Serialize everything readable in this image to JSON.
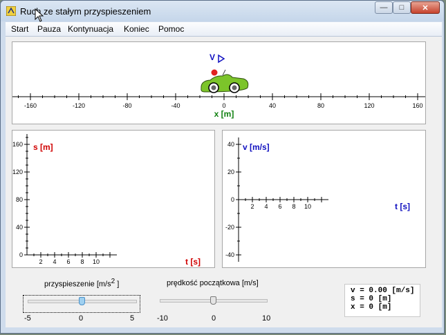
{
  "window": {
    "title": "Ruch ze stałym przyspieszeniem"
  },
  "menu": {
    "items": [
      "Start",
      "Pauza",
      "Kontynuacja",
      "Koniec",
      "Pomoc"
    ]
  },
  "track": {
    "axis_label": "x [m]",
    "ticks": [
      "-160",
      "-120",
      "-80",
      "-40",
      "0",
      "40",
      "80",
      "120",
      "160"
    ],
    "velocity_label": "V",
    "car_position_m": 0
  },
  "chart_data": [
    {
      "type": "line",
      "ylabel": "s [m]",
      "xlabel": "t [s]",
      "xlim": [
        0,
        13
      ],
      "ylim": [
        0,
        175
      ],
      "x_ticks": [
        "2",
        "4",
        "6",
        "8",
        "10"
      ],
      "y_ticks": [
        "0",
        "40",
        "80",
        "120",
        "160"
      ],
      "series": [
        {
          "values": []
        }
      ]
    },
    {
      "type": "line",
      "ylabel": "v [m/s]",
      "xlabel": "t [s]",
      "xlim": [
        0,
        13
      ],
      "ylim": [
        -45,
        45
      ],
      "x_ticks": [
        "2",
        "4",
        "6",
        "8",
        "10"
      ],
      "y_ticks": [
        "40",
        "20",
        "0",
        "-20",
        "-40"
      ],
      "series": [
        {
          "values": []
        }
      ]
    }
  ],
  "controls": {
    "acceleration": {
      "label": "przyspieszenie [m/s",
      "exponent": "2",
      "label_end": " ]",
      "min_label": "-5",
      "mid_label": "0",
      "max_label": "5",
      "min": -5,
      "max": 5,
      "value": 0
    },
    "velocity": {
      "label": "prędkość początkowa [m/s]",
      "min_label": "-10",
      "mid_label": "0",
      "max_label": "10",
      "min": -10,
      "max": 10,
      "value": 0
    }
  },
  "readout": {
    "v": "v = 0.00 [m/s]",
    "s": "s = 0 [m]",
    "x": "x = 0 [m]"
  },
  "colors": {
    "s_axis": "#d00000",
    "v_axis": "#1010c0",
    "x_axis": "#108010",
    "car": "#7cc42a"
  }
}
